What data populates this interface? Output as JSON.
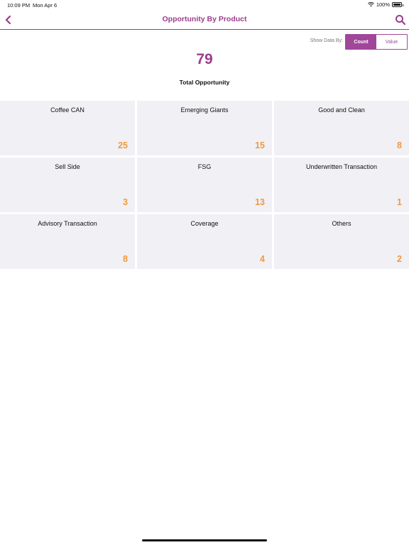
{
  "status_bar": {
    "time": "10:09 PM",
    "date": "Mon Apr 6",
    "battery": "100%",
    "battery_level": 1.0
  },
  "header": {
    "title": "Opportunity By Product",
    "back_icon": "chevron-left-icon",
    "search_icon": "search-icon"
  },
  "toggle": {
    "label": "Show Data By:",
    "options": [
      "Count",
      "Value"
    ],
    "selected": "Count"
  },
  "summary": {
    "total": "79",
    "label": "Total Opportunity"
  },
  "tiles": [
    {
      "name": "Coffee CAN",
      "count": "25"
    },
    {
      "name": "Emerging Giants",
      "count": "15"
    },
    {
      "name": "Good and Clean",
      "count": "8"
    },
    {
      "name": "Sell Side",
      "count": "3"
    },
    {
      "name": "FSG",
      "count": "13"
    },
    {
      "name": "Underwritten Transaction",
      "count": "1"
    },
    {
      "name": "Advisory Transaction",
      "count": "8"
    },
    {
      "name": "Coverage",
      "count": "4"
    },
    {
      "name": "Others",
      "count": "2"
    }
  ],
  "colors": {
    "accent": "#9b3d8c",
    "count": "#ef9a3f",
    "tile_bg": "#f1f0f4"
  }
}
